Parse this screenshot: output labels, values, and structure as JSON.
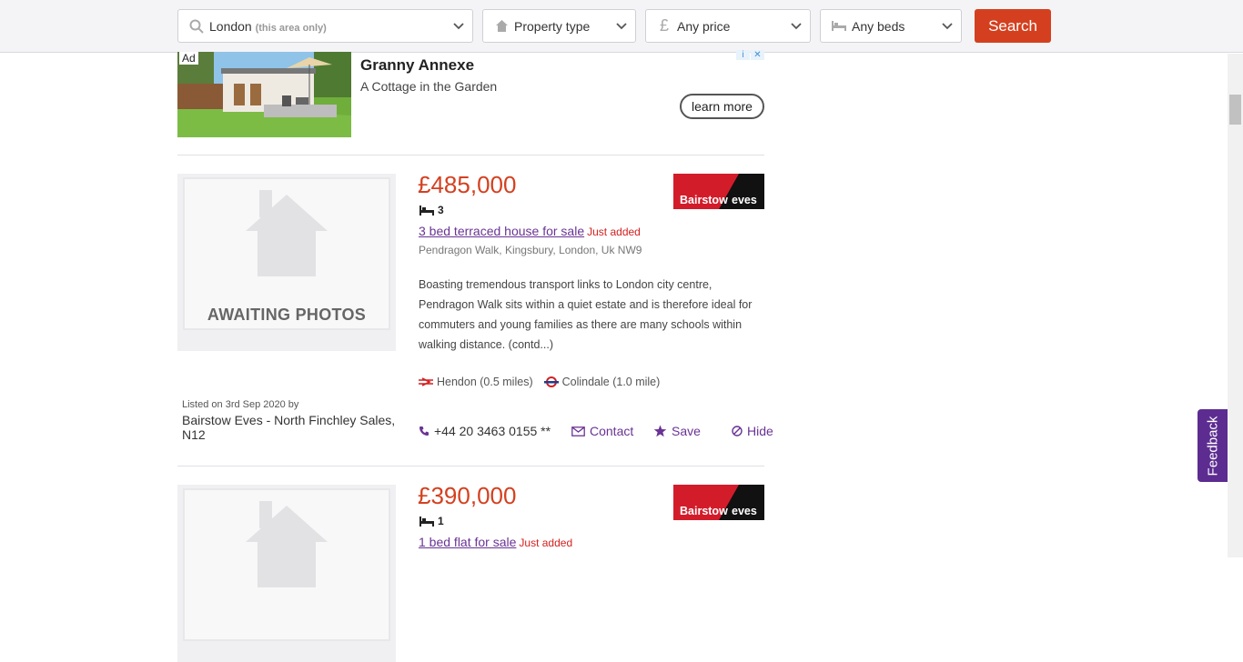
{
  "search": {
    "location_value": "London",
    "location_hint": "(this area only)",
    "property_type": "Property type",
    "price": "Any price",
    "beds": "Any beds",
    "search_label": "Search"
  },
  "ad": {
    "badge": "Ad",
    "title": "Granny Annexe",
    "subtitle": "A Cottage in the Garden",
    "cta": "learn more",
    "info_icon": "i",
    "close_icon": "✕"
  },
  "listings": [
    {
      "price": "£485,000",
      "beds": "3",
      "title": "3 bed terraced house for sale",
      "badge": "Just added",
      "address": "Pendragon Walk, Kingsbury, London, Uk NW9",
      "description": "Boasting tremendous transport links to London city centre, Pendragon Walk sits within a quiet estate and is therefore ideal for commuters and young families as there are many schools within walking distance. (contd...)",
      "stations": [
        {
          "icon": "national-rail-icon",
          "label": "Hendon (0.5 miles)"
        },
        {
          "icon": "underground-icon",
          "label": "Colindale (1.0 mile)"
        }
      ],
      "agent_logo_text_1": "Bairstow",
      "agent_logo_text_2": "eves",
      "placeholder_text": "AWAITING PHOTOS",
      "listed": "Listed on 3rd Sep 2020 by",
      "agent_name": "Bairstow Eves - North Finchley Sales, N12",
      "phone": "+44 20 3463 0155 **",
      "contact": "Contact",
      "save": "Save",
      "hide": "Hide"
    },
    {
      "price": "£390,000",
      "beds": "1",
      "title": "1 bed flat for sale",
      "badge": "Just added",
      "agent_logo_text_1": "Bairstow",
      "agent_logo_text_2": "eves"
    }
  ],
  "feedback": "Feedback",
  "colors": {
    "accent": "#d4401f",
    "link": "#6a3394",
    "feedback": "#5c2c91",
    "agent": "#d31c2a"
  }
}
